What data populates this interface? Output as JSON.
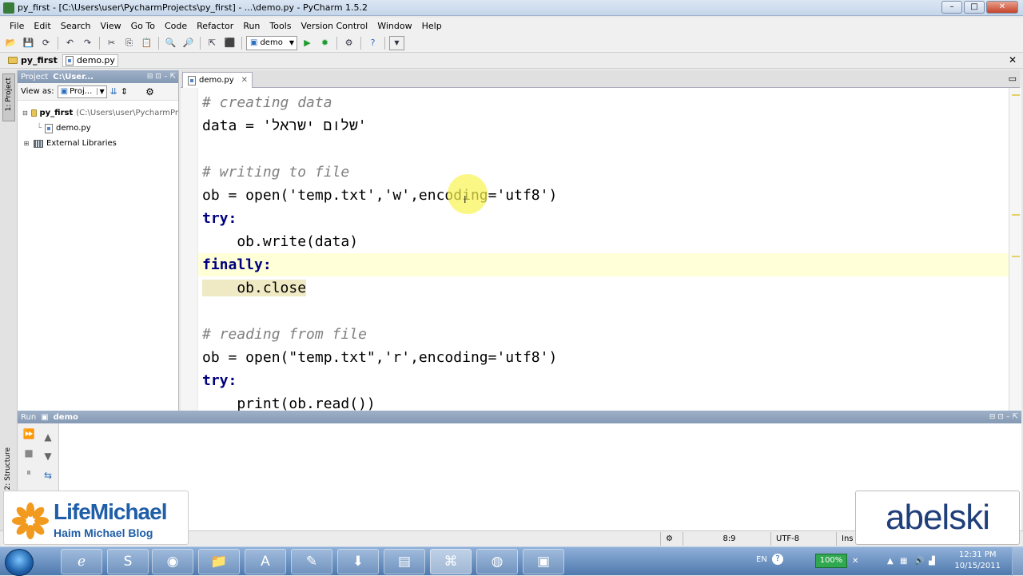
{
  "window": {
    "title": "py_first - [C:\\Users\\user\\PycharmProjects\\py_first] - ...\\demo.py - PyCharm 1.5.2",
    "controls": [
      "–",
      "□",
      "✕"
    ]
  },
  "menu": [
    "File",
    "Edit",
    "Search",
    "View",
    "Go To",
    "Code",
    "Refactor",
    "Run",
    "Tools",
    "Version Control",
    "Window",
    "Help"
  ],
  "toolbar": {
    "run_config": "demo",
    "icons": [
      "open-icon",
      "save-icon",
      "sync-icon",
      "undo-icon",
      "redo-icon",
      "cut-icon",
      "copy-icon",
      "paste-icon",
      "find-icon",
      "replace-icon",
      "back-icon",
      "forward-icon",
      "run-config-dropdown",
      "run-icon",
      "debug-icon",
      "settings-icon",
      "help-icon",
      "dropdown-icon"
    ]
  },
  "nav": {
    "project": "py_first",
    "file": "demo.py"
  },
  "project_panel": {
    "header": "Project",
    "path_short": "C:\\User...",
    "view_as_label": "View as:",
    "view_as_value": "Proj...",
    "tree": [
      {
        "label": "py_first",
        "path": "(C:\\Users\\user\\PycharmPr"
      },
      {
        "label": "demo.py"
      },
      {
        "label": "External Libraries"
      }
    ]
  },
  "side_tabs": {
    "project": "1: Project",
    "structure": "2: Structure"
  },
  "editor": {
    "tab_label": "demo.py",
    "lines": [
      "# creating data",
      "data = 'שלום ישראל'",
      "",
      "# writing to file",
      "ob = open('temp.txt','w',encoding='utf8')",
      "try:",
      "    ob.write(data)",
      "finally:",
      "    ob.close",
      "",
      "# reading from file",
      "ob = open(\"temp.txt\",'r',encoding='utf8')",
      "try:",
      "    print(ob.read())"
    ]
  },
  "run_panel": {
    "label": "Run",
    "config": "demo"
  },
  "status": {
    "position": "8:9",
    "encoding": "UTF-8",
    "insert_mode": "Ins"
  },
  "taskbar": {
    "apps": [
      "ie",
      "skype",
      "chrome",
      "explorer",
      "acrobat",
      "notepad",
      "download",
      "office",
      "pycharm",
      "firefox",
      "app"
    ],
    "lang": "EN",
    "zoom": "100%",
    "time": "12:31 PM",
    "date": "10/15/2011"
  },
  "branding": {
    "left_brand": "LifeMichael",
    "left_tagline": "Haim Michael Blog",
    "right_brand": "abelski"
  },
  "colors": {
    "comment": "#808080",
    "string": "#008000",
    "keyword": "#000080",
    "caret_line": "#ffffd8",
    "panel_header": "#8fa3bd",
    "taskbar": "#4f79ae"
  }
}
